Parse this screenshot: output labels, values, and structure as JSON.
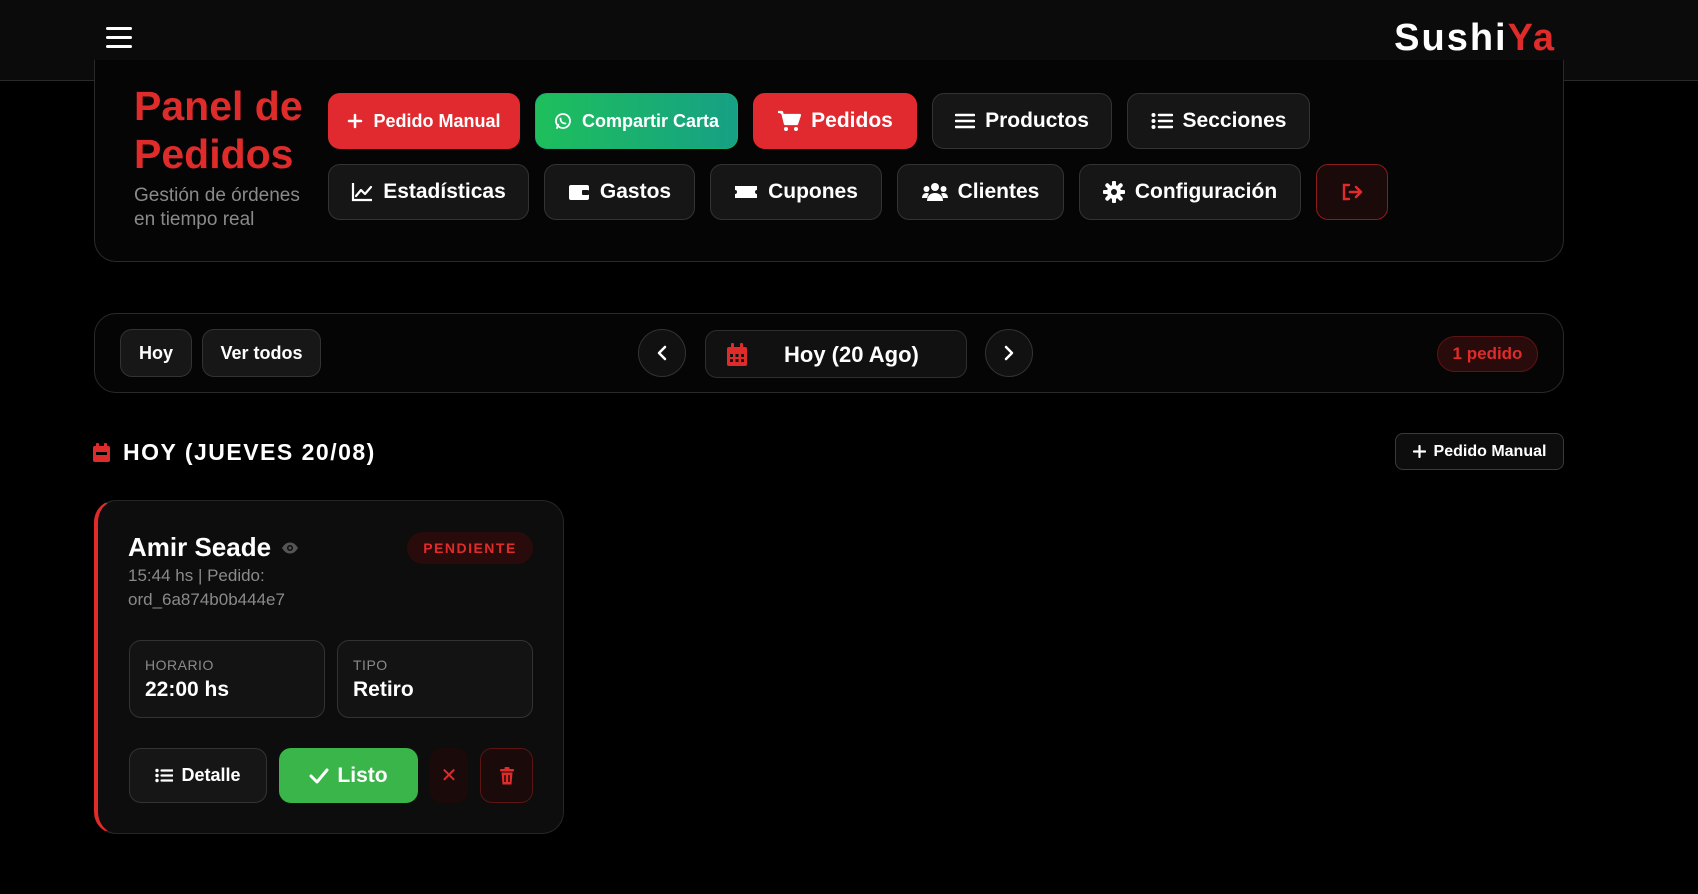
{
  "app": {
    "brand_part1": "Sushi",
    "brand_part2": "Ya"
  },
  "header": {
    "title": "Panel de Pedidos",
    "subtitle": "Gestión de órdenes en tiempo real"
  },
  "nav": {
    "manual_order": "Pedido Manual",
    "share_menu": "Compartir Carta",
    "orders": "Pedidos",
    "products": "Productos",
    "sections": "Secciones",
    "stats": "Estadísticas",
    "expenses": "Gastos",
    "coupons": "Cupones",
    "clients": "Clientes",
    "settings": "Configuración"
  },
  "datebar": {
    "today": "Hoy",
    "see_all": "Ver todos",
    "current_date": "Hoy (20 Ago)",
    "count": "1 pedido"
  },
  "section": {
    "title": "HOY (JUEVES 20/08)",
    "manual_order": "Pedido Manual"
  },
  "order": {
    "customer": "Amir Seade",
    "status": "PENDIENTE",
    "meta": "15:44 hs | Pedido: ord_6a874b0b444e7",
    "schedule_label": "HORARIO",
    "schedule_value": "22:00 hs",
    "type_label": "TIPO",
    "type_value": "Retiro",
    "detail_label": "Detalle",
    "ready_label": "Listo",
    "cancel_symbol": "✕"
  },
  "colors": {
    "accent_red": "#e02b2b",
    "success_green": "#3ab54a",
    "whatsapp_green": "#1ebf5c",
    "background": "#000000"
  }
}
